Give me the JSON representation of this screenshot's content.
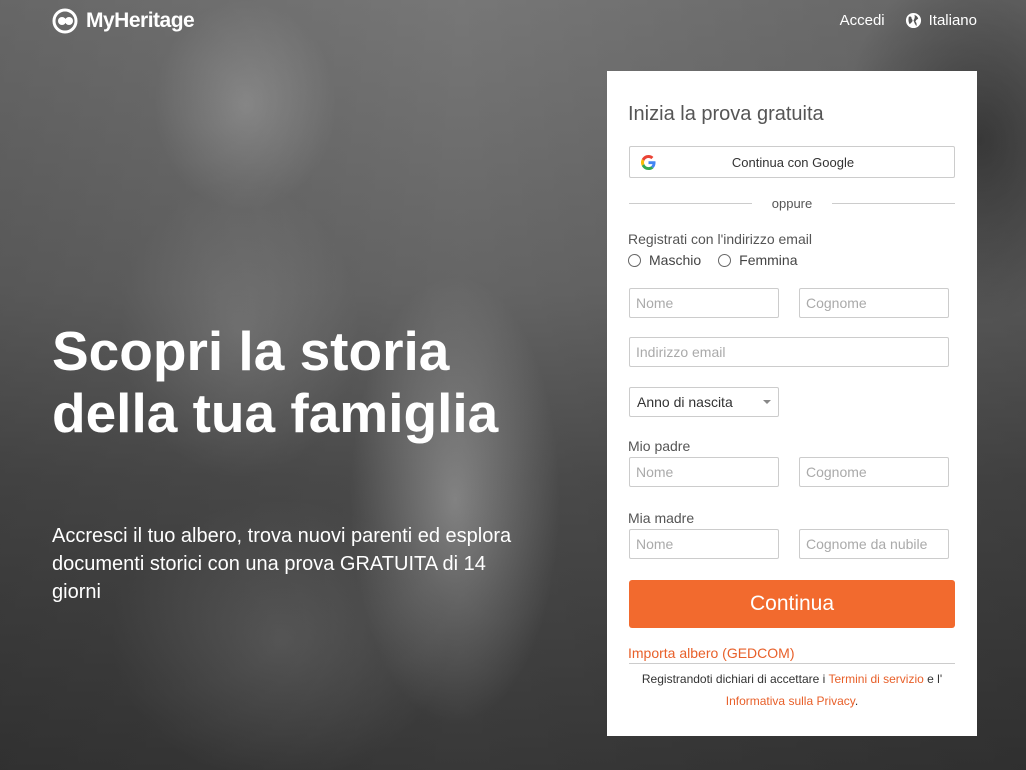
{
  "header": {
    "logo_text": "MyHeritage",
    "login_label": "Accedi",
    "language_label": "Italiano"
  },
  "hero": {
    "title": "Scopri la storia della tua famiglia",
    "subtitle": "Accresci il tuo albero, trova nuovi parenti ed esplora documenti storici con una prova GRATUITA di 14 giorni"
  },
  "form": {
    "title": "Inizia la prova gratuita",
    "google_button": "Continua con Google",
    "divider": "oppure",
    "email_section_label": "Registrati con l'indirizzo email",
    "gender": {
      "male": "Maschio",
      "female": "Femmina"
    },
    "first_name_placeholder": "Nome",
    "last_name_placeholder": "Cognome",
    "email_placeholder": "Indirizzo email",
    "birth_year_selected": "Anno di nascita",
    "father": {
      "label": "Mio padre",
      "first_name_placeholder": "Nome",
      "last_name_placeholder": "Cognome"
    },
    "mother": {
      "label": "Mia madre",
      "first_name_placeholder": "Nome",
      "maiden_name_placeholder": "Cognome da nubile"
    },
    "submit_label": "Continua",
    "gedcom_link": "Importa albero (GEDCOM)",
    "legal": {
      "prefix": "Registrandoti dichiari di accettare i",
      "terms_link": "Termini di servizio",
      "conjunction": "e l'",
      "privacy_link": "Informativa sulla Privacy",
      "suffix": "."
    }
  },
  "colors": {
    "accent": "#f26a2e",
    "link": "#e8602a",
    "panel_bg": "#ffffff"
  },
  "icons": {
    "logo": "myheritage-logo-icon",
    "language": "globe-icon",
    "google": "google-icon",
    "select_caret": "caret-down-icon"
  }
}
